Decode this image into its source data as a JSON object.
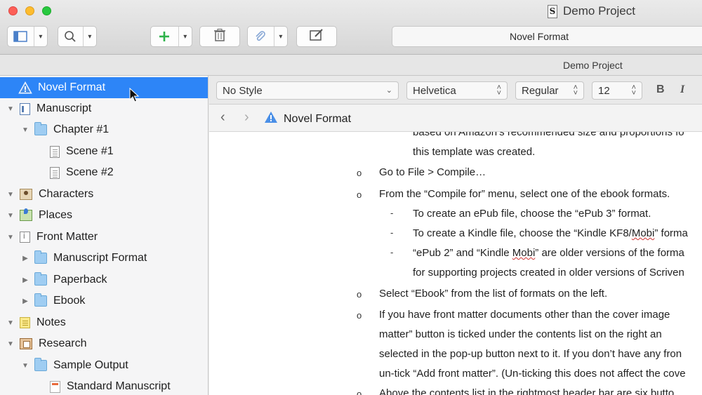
{
  "window": {
    "title": "Demo Project",
    "subtitle": "Demo Project"
  },
  "toolbar": {
    "format_label": "Novel Format"
  },
  "binder": {
    "items": [
      {
        "label": "Novel Format",
        "icon": "warning-icon",
        "selected": true
      },
      {
        "label": "Manuscript",
        "icon": "manuscript-icon",
        "expanded": true
      },
      {
        "label": "Chapter #1",
        "icon": "folder-icon",
        "expanded": true
      },
      {
        "label": "Scene #1",
        "icon": "page-icon"
      },
      {
        "label": "Scene #2",
        "icon": "page-icon"
      },
      {
        "label": "Characters",
        "icon": "characters-icon",
        "expanded": true
      },
      {
        "label": "Places",
        "icon": "places-icon",
        "expanded": true
      },
      {
        "label": "Front Matter",
        "icon": "front-matter-icon",
        "expanded": true
      },
      {
        "label": "Manuscript Format",
        "icon": "folder-icon",
        "expanded": false
      },
      {
        "label": "Paperback",
        "icon": "folder-icon",
        "expanded": false
      },
      {
        "label": "Ebook",
        "icon": "folder-icon",
        "expanded": false
      },
      {
        "label": "Notes",
        "icon": "notes-icon",
        "expanded": true
      },
      {
        "label": "Research",
        "icon": "research-icon",
        "expanded": true
      },
      {
        "label": "Sample Output",
        "icon": "folder-icon",
        "expanded": true
      },
      {
        "label": "Standard Manuscript",
        "icon": "pdf-icon"
      }
    ]
  },
  "format_bar": {
    "style": "No Style",
    "font": "Helvetica",
    "weight": "Regular",
    "size": "12",
    "bold": "B",
    "italic": "I"
  },
  "editor_header": {
    "title": "Novel Format"
  },
  "editor": {
    "lines": [
      "based on Amazon’s recommended size and proportions fo",
      "this template was created.",
      "Go to File > Compile…",
      "From the “Compile for” menu, select one of the ebook formats.",
      "To create an ePub file, choose the “ePub 3” format.",
      "To create a Kindle file, choose the “Kindle KF8/",
      "Mobi",
      "” forma",
      "“ePub 2” and “Kindle ",
      "Mobi",
      "” are older versions of the forma",
      "for supporting projects created in older versions of Scriven",
      "Select “Ebook” from the list of formats on the left.",
      "If you have front matter documents other than the cover image",
      "matter” button is ticked under the contents list on the right an",
      "selected in the pop-up button next to it. If you don’t have any fron",
      "un-tick “Add front matter”. (Un-ticking this does not affect the cove",
      "Above the contents list in the rightmost header bar are six butto"
    ],
    "bullet_o": "o",
    "bullet_dash": "-"
  },
  "colors": {
    "selection": "#2d85f7",
    "accent_green": "#2eb34a"
  }
}
